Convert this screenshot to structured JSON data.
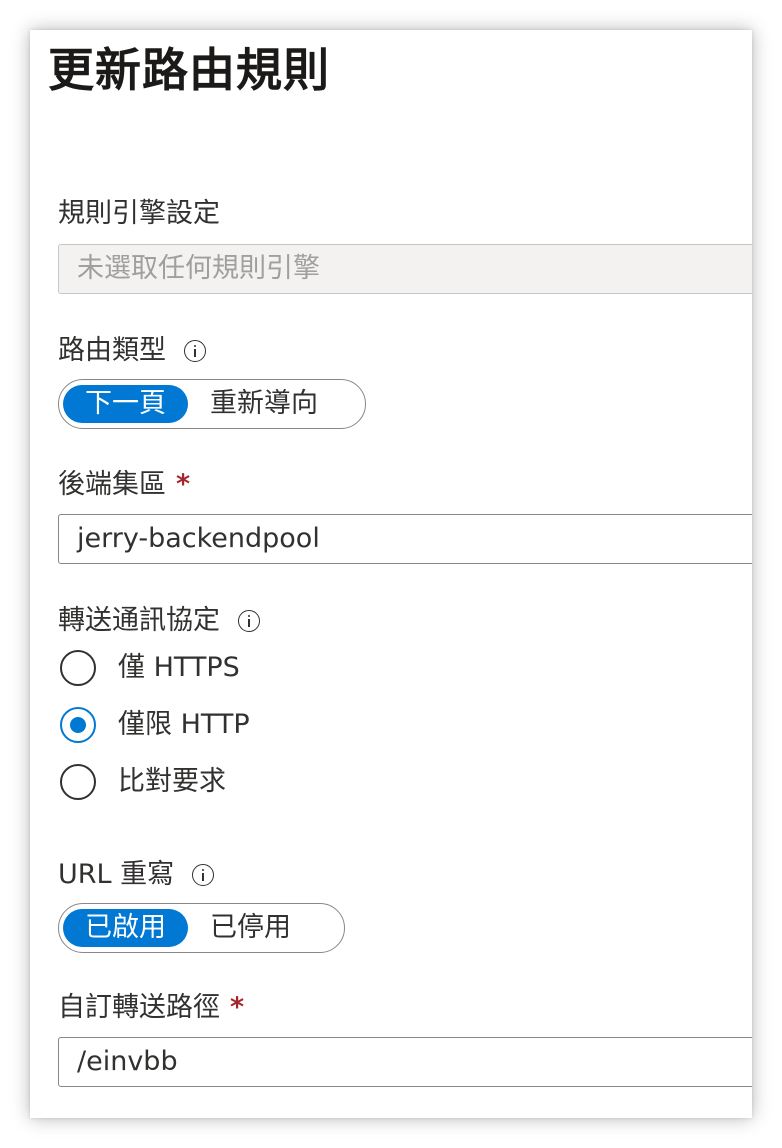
{
  "panel": {
    "title": "更新路由規則"
  },
  "rule_engine": {
    "label": "規則引擎設定",
    "value": "未選取任何規則引擎"
  },
  "route_type": {
    "label": "路由類型",
    "options": [
      "下一頁",
      "重新導向"
    ],
    "selected": "下一頁"
  },
  "backend_pool": {
    "label": "後端集區",
    "required_mark": "*",
    "value": "jerry-backendpool"
  },
  "forwarding_protocol": {
    "label": "轉送通訊協定",
    "options": [
      "僅 HTTPS",
      "僅限 HTTP",
      "比對要求"
    ],
    "selected": "僅限 HTTP"
  },
  "url_rewrite": {
    "label": "URL 重寫",
    "options": [
      "已啟用",
      "已停用"
    ],
    "selected": "已啟用"
  },
  "custom_forwarding_path": {
    "label": "自訂轉送路徑",
    "required_mark": "*",
    "value": "/einvbb"
  },
  "colors": {
    "accent": "#0078d4",
    "required": "#a4262c",
    "border": "#8a8886",
    "disabled_bg": "#f3f2f1"
  },
  "icons": [
    "info-icon",
    "radio-unchecked",
    "radio-checked"
  ]
}
